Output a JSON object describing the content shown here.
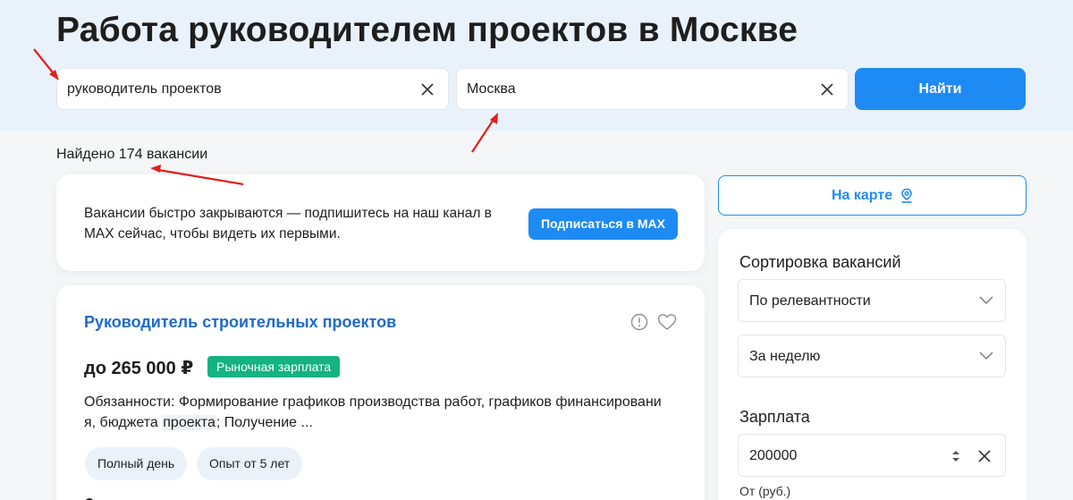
{
  "page": {
    "title": "Работа руководителем проектов в Москве"
  },
  "search": {
    "query_value": "руководитель проектов",
    "city_value": "Москва",
    "submit_label": "Найти"
  },
  "results": {
    "found_text": "Найдено 174 вакансии"
  },
  "promo": {
    "text": "Вакансии быстро закрываются — подпишитесь на наш канал в MAX сейчас, чтобы видеть их первыми.",
    "button_label": "Подписаться в MAX"
  },
  "vacancy": {
    "title": "Руководитель строительных проектов",
    "salary": "до 265 000 ₽",
    "salary_badge": "Рыночная зарплата",
    "desc_before": "Обязанности: Формирование графиков производства работ, графиков финансировани я, бюджета ",
    "desc_highlight": "проекта",
    "desc_after": "; Получение ...",
    "tags": [
      "Полный день",
      "Опыт от 5 лет"
    ]
  },
  "sidebar": {
    "map_button_label": "На карте",
    "sort_heading": "Сортировка вакансий",
    "sort_value": "По релевантности",
    "period_value": "За неделю",
    "salary_heading": "Зарплата",
    "salary_value": "200000",
    "salary_sub": "От (руб.)"
  },
  "colors": {
    "accent": "#1e8bf5",
    "link": "#1f6ac9",
    "badge_green": "#14b380",
    "hero_bg": "#e9f1fb",
    "annotation_red": "#e0201e"
  },
  "icons": [
    "clear-icon",
    "map-pin-icon",
    "info-icon",
    "heart-icon",
    "chevron-down-icon",
    "stepper-icon"
  ]
}
